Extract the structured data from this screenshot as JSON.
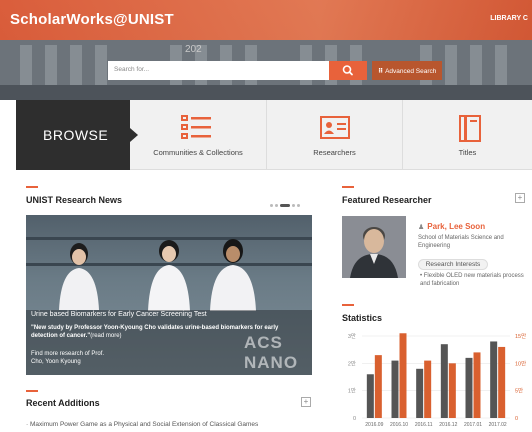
{
  "header": {
    "logo": "ScholarWorks@UNIST",
    "library_link": "LIBRARY C",
    "search_placeholder": "Search for...",
    "advanced_search": "Advanced Search"
  },
  "browse": {
    "label": "BROWSE",
    "items": [
      {
        "label": "Communities & Collections",
        "icon": "list-icon"
      },
      {
        "label": "Researchers",
        "icon": "id-card-icon"
      },
      {
        "label": "Titles",
        "icon": "book-icon"
      }
    ]
  },
  "news": {
    "section_title": "UNIST Research News",
    "slide_title": "Urine based Biomarkers for Early Cancer Screening Test",
    "slide_desc": "\"New study by Professor Yoon-Kyoung Cho validates urine-based biomarkers for early detection of cancer.\"",
    "read_more": "(read more)",
    "find_more_line1": "Find more research of Prof.",
    "find_more_line2": "Cho, Yoon Kyoung",
    "image_text": "ACS NANO"
  },
  "recent": {
    "section_title": "Recent Additions",
    "plus": "+",
    "first_item": "· Maximum Power Game as a Physical and Social Extension of Classical Games"
  },
  "featured": {
    "section_title": "Featured Researcher",
    "plus": "+",
    "name": "Park, Lee Soon",
    "department": "School of Materials Science and Engineering",
    "interests_button": "Research Interests",
    "interests": "• Flexible OLED new materials process and fabrication"
  },
  "statistics": {
    "section_title": "Statistics"
  },
  "chart_data": {
    "type": "bar",
    "categories": [
      "2016.09",
      "2016.10",
      "2016.11",
      "2016.12",
      "2017.01",
      "2017.02"
    ],
    "series": [
      {
        "values": [
          16000,
          21000,
          18000,
          27000,
          22000,
          28000
        ],
        "color": "#555555"
      },
      {
        "values": [
          11500,
          15500,
          10500,
          10000,
          12000,
          13000
        ],
        "color": "#d9602f"
      }
    ],
    "left_axis": {
      "ticks": [
        "3만",
        "2만",
        "1만",
        "0"
      ],
      "ylim": [
        0,
        30000
      ]
    },
    "right_axis": {
      "ticks": [
        "15만",
        "10만",
        "5만",
        "0"
      ],
      "ylim": [
        0,
        15000
      ]
    },
    "colors": {
      "dark": "#555555",
      "orange": "#d9602f"
    }
  },
  "colors": {
    "accent": "#e8623b",
    "browse_bg": "#2e2e2e"
  }
}
